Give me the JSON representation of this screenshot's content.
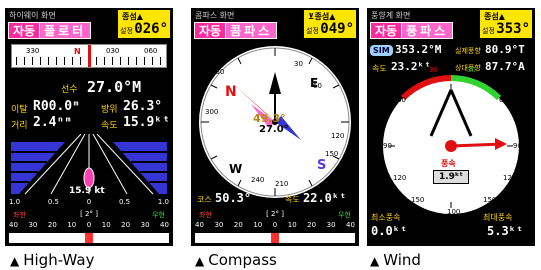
{
  "panels": {
    "highway": {
      "title": "하이웨이 화면",
      "mode_tag": "자동",
      "mode_name": "플로터",
      "status_top": "종섬▲",
      "set_label": "설정",
      "set_value": "026°",
      "compass_ticks": [
        "330",
        "N",
        "030",
        "060"
      ],
      "heading_label": "선수",
      "heading_value": "27.0°M",
      "distance_label": "이탈",
      "distance_value": "R00.0ᵐ",
      "bearing_label": "방위",
      "bearing_value": "26.3°",
      "range_label": "거리",
      "range_value": "2.4ⁿᵐ",
      "speed_label": "속도",
      "speed_value": "15.9ᵏᵗ",
      "boat_speed": "15.9 kt",
      "lane_scale": [
        "1.0",
        "0.5",
        "0",
        "0.5",
        "1.0"
      ],
      "bottom_left": "좌현",
      "bottom_center": "[ 2° ]",
      "bottom_right": "우현",
      "rudder_scale": [
        "40",
        "30",
        "20",
        "10",
        "0",
        "10",
        "20",
        "30",
        "40"
      ]
    },
    "compass": {
      "title": "콤파스 화면",
      "mode_tag": "자동",
      "mode_name": "콤파스",
      "status_top": "⊻종섬▲",
      "set_label": "설정",
      "set_value": "049°",
      "cardinals": {
        "n": "N",
        "e": "E",
        "s": "S",
        "w": "W"
      },
      "dial_ticks": [
        "30",
        "60",
        "120",
        "150",
        "210",
        "240",
        "300",
        "330"
      ],
      "needle_value": "49.3°",
      "needle_value2": "27.0°",
      "course_label": "코스",
      "course_value": "50.3°",
      "speed_label": "속도",
      "speed_value": "22.0ᵏᵗ",
      "bottom_left": "좌현",
      "bottom_center": "[ 2° ]",
      "bottom_right": "우현",
      "rudder_scale": [
        "40",
        "30",
        "20",
        "10",
        "0",
        "10",
        "20",
        "30",
        "40"
      ]
    },
    "wind": {
      "title": "풍향계 화면",
      "mode_tag": "자동",
      "mode_name": "풍파스",
      "status_top": "종섬▲",
      "set_label": "설정",
      "set_value": "353°",
      "sim_badge": "SIM",
      "heading_value": "353.2°M",
      "real_dir_label": "실제풍향",
      "real_dir_value": "80.9°T",
      "speed_label": "속도",
      "speed_value": "23.2ᵏᵗ",
      "rel_dir_label": "상대풍향",
      "rel_dir_value": "87.7°A",
      "dial_ticks": [
        "30",
        "60",
        "90",
        "120",
        "150",
        "100",
        "150",
        "120",
        "90",
        "60",
        "30"
      ],
      "wind_label": "풍속",
      "wind_value": "1.9ᵏᵗ",
      "min_label": "최소풍속",
      "min_value": "0.0ᵏᵗ",
      "max_label": "최대풍속",
      "max_value": "5.3ᵏᵗ"
    }
  },
  "captions": {
    "highway": "High-Way",
    "compass": "Compass",
    "wind": "Wind"
  },
  "colors": {
    "accent_yellow": "#ffd200",
    "mode_pink": "#ff66cc",
    "port_red": "#ff3b3b",
    "starboard_green": "#31d331",
    "lane_blue": "#3535d6"
  }
}
